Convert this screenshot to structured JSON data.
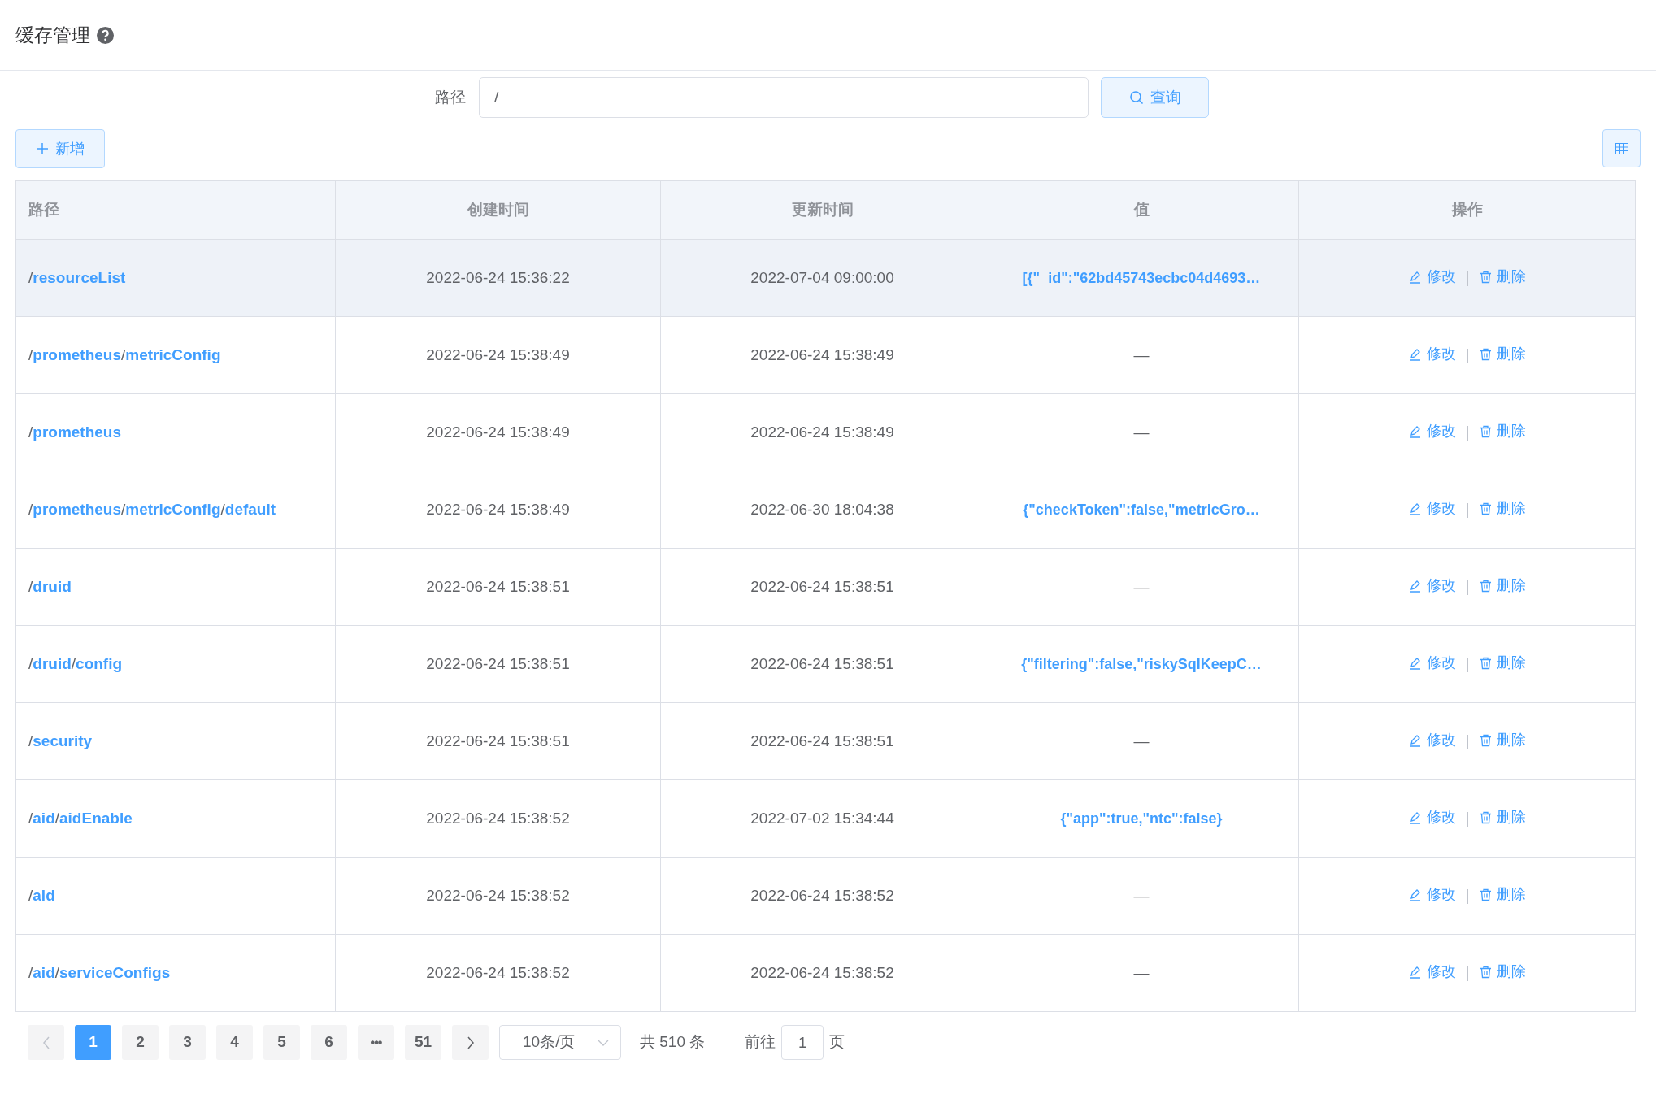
{
  "header": {
    "title": "缓存管理"
  },
  "search_form": {
    "label": "路径",
    "value": "/",
    "button": "查询"
  },
  "toolbar": {
    "add_button": "新增"
  },
  "table": {
    "columns": [
      "路径",
      "创建时间",
      "更新时间",
      "值",
      "操作"
    ],
    "rows": [
      {
        "path": "/**resourceList**",
        "created": "2022-06-24 15:36:22",
        "updated": "2022-07-04 09:00:00",
        "value": "[{\"_id\":\"62bd45743ecbc04d4693…",
        "kind": "json",
        "hovered": true,
        "actions": [
          "修改",
          "删除"
        ]
      },
      {
        "path": "/**prometheus**/**metricConfig**",
        "created": "2022-06-24 15:38:49",
        "updated": "2022-06-24 15:38:49",
        "value": "—",
        "kind": "empty",
        "hovered": false,
        "actions": [
          "修改",
          "删除"
        ]
      },
      {
        "path": "/**prometheus**",
        "created": "2022-06-24 15:38:49",
        "updated": "2022-06-24 15:38:49",
        "value": "—",
        "kind": "empty",
        "hovered": false,
        "actions": [
          "修改",
          "删除"
        ]
      },
      {
        "path": "/**prometheus**/**metricConfig**/**default**",
        "created": "2022-06-24 15:38:49",
        "updated": "2022-06-30 18:04:38",
        "value": "{\"checkToken\":false,\"metricGro…",
        "kind": "json",
        "hovered": false,
        "actions": [
          "修改",
          "删除"
        ]
      },
      {
        "path": "/**druid**",
        "created": "2022-06-24 15:38:51",
        "updated": "2022-06-24 15:38:51",
        "value": "—",
        "kind": "empty",
        "hovered": false,
        "actions": [
          "修改",
          "删除"
        ]
      },
      {
        "path": "/**druid**/**config**",
        "created": "2022-06-24 15:38:51",
        "updated": "2022-06-24 15:38:51",
        "value": "{\"filtering\":false,\"riskySqlKeepC…",
        "kind": "json",
        "hovered": false,
        "actions": [
          "修改",
          "删除"
        ]
      },
      {
        "path": "/**security**",
        "created": "2022-06-24 15:38:51",
        "updated": "2022-06-24 15:38:51",
        "value": "—",
        "kind": "empty",
        "hovered": false,
        "actions": [
          "修改",
          "删除"
        ]
      },
      {
        "path": "/**aid**/**aidEnable**",
        "created": "2022-06-24 15:38:52",
        "updated": "2022-07-02 15:34:44",
        "value": "{\"app\":true,\"ntc\":false}",
        "kind": "json",
        "hovered": false,
        "actions": [
          "修改",
          "删除"
        ]
      },
      {
        "path": "/**aid**",
        "created": "2022-06-24 15:38:52",
        "updated": "2022-06-24 15:38:52",
        "value": "—",
        "kind": "empty",
        "hovered": false,
        "actions": [
          "修改",
          "删除"
        ]
      },
      {
        "path": "/**aid**/**serviceConfigs**",
        "created": "2022-06-24 15:38:52",
        "updated": "2022-06-24 15:38:52",
        "value": "—",
        "kind": "empty",
        "hovered": false,
        "actions": [
          "修改",
          "删除"
        ]
      }
    ]
  },
  "pagination": {
    "prev_disabled": true,
    "pages": [
      {
        "label": "1",
        "kind": "page",
        "selected": true
      },
      {
        "label": "2",
        "kind": "page",
        "selected": false
      },
      {
        "label": "3",
        "kind": "page",
        "selected": false
      },
      {
        "label": "4",
        "kind": "page",
        "selected": false
      },
      {
        "label": "5",
        "kind": "page",
        "selected": false
      },
      {
        "label": "6",
        "kind": "page",
        "selected": false
      },
      {
        "label": "•••",
        "kind": "more",
        "selected": false
      },
      {
        "label": "51",
        "kind": "page",
        "selected": false
      }
    ],
    "page_size": "10条/页",
    "total": "共 510 条",
    "goto_label": "前往",
    "goto_value": "1",
    "goto_suffix": "页"
  }
}
